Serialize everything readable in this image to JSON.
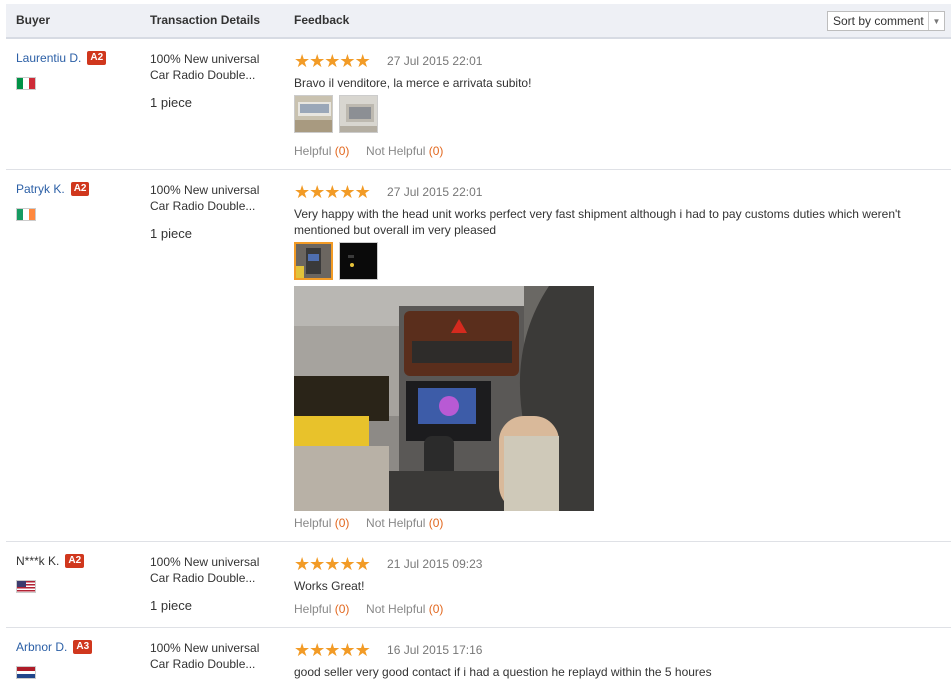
{
  "header": {
    "col_buyer": "Buyer",
    "col_transaction": "Transaction Details",
    "col_feedback": "Feedback",
    "sort_label": "Sort by comment"
  },
  "reviews": [
    {
      "buyer": "Laurentiu D.",
      "badge": "A2",
      "country_flag": "italy-flag",
      "product": "100% New universal Car Radio Double...",
      "quantity": "1 piece",
      "rating": 5,
      "date": "27 Jul 2015 22:01",
      "comment": "Bravo il venditore, la merce e arrivata subito!",
      "helpful_label": "Helpful",
      "helpful_count": "(0)",
      "not_helpful_label": "Not Helpful",
      "not_helpful_count": "(0)"
    },
    {
      "buyer": "Patryk K.",
      "badge": "A2",
      "country_flag": "ireland-flag",
      "product": "100% New universal Car Radio Double...",
      "quantity": "1 piece",
      "rating": 5,
      "date": "27 Jul 2015 22:01",
      "comment": "Very happy with the head unit works perfect very fast shipment although i had to pay customs duties which weren't mentioned but overall im very pleased",
      "helpful_label": "Helpful",
      "helpful_count": "(0)",
      "not_helpful_label": "Not Helpful",
      "not_helpful_count": "(0)"
    },
    {
      "buyer": "N***k K.",
      "badge": "A2",
      "country_flag": "usa-flag",
      "product": "100% New universal Car Radio Double...",
      "quantity": "1 piece",
      "rating": 5,
      "date": "21 Jul 2015 09:23",
      "comment": "Works Great!",
      "helpful_label": "Helpful",
      "helpful_count": "(0)",
      "not_helpful_label": "Not Helpful",
      "not_helpful_count": "(0)"
    },
    {
      "buyer": "Arbnor D.",
      "badge": "A3",
      "country_flag": "netherlands-flag",
      "product": "100% New universal Car Radio Double...",
      "rating": 5,
      "date": "16 Jul 2015 17:16",
      "comment": "good seller very good contact if i had a question he replayd within the 5 houres"
    }
  ],
  "colors": {
    "link_blue": "#2b5fa6",
    "badge_red": "#d0371d",
    "star_orange": "#f29b26",
    "count_orange": "#e2681f"
  }
}
